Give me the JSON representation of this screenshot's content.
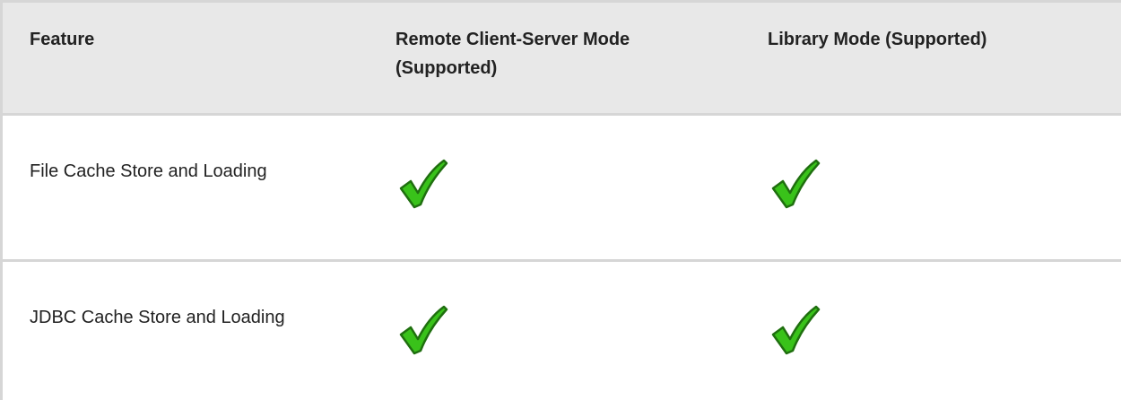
{
  "table": {
    "headers": [
      "Feature",
      "Remote Client-Server Mode (Supported)",
      "Library Mode (Supported)"
    ],
    "rows": [
      {
        "feature": "File Cache Store and Loading",
        "remote": "supported",
        "library": "supported"
      },
      {
        "feature": "JDBC Cache Store and Loading",
        "remote": "supported",
        "library": "supported"
      }
    ]
  },
  "colors": {
    "header_bg": "#e8e8e8",
    "border": "#d6d6d6",
    "check_green": "#39c21a",
    "check_outline": "#1f6f0f"
  },
  "icons": {
    "supported": "checkmark-icon"
  }
}
